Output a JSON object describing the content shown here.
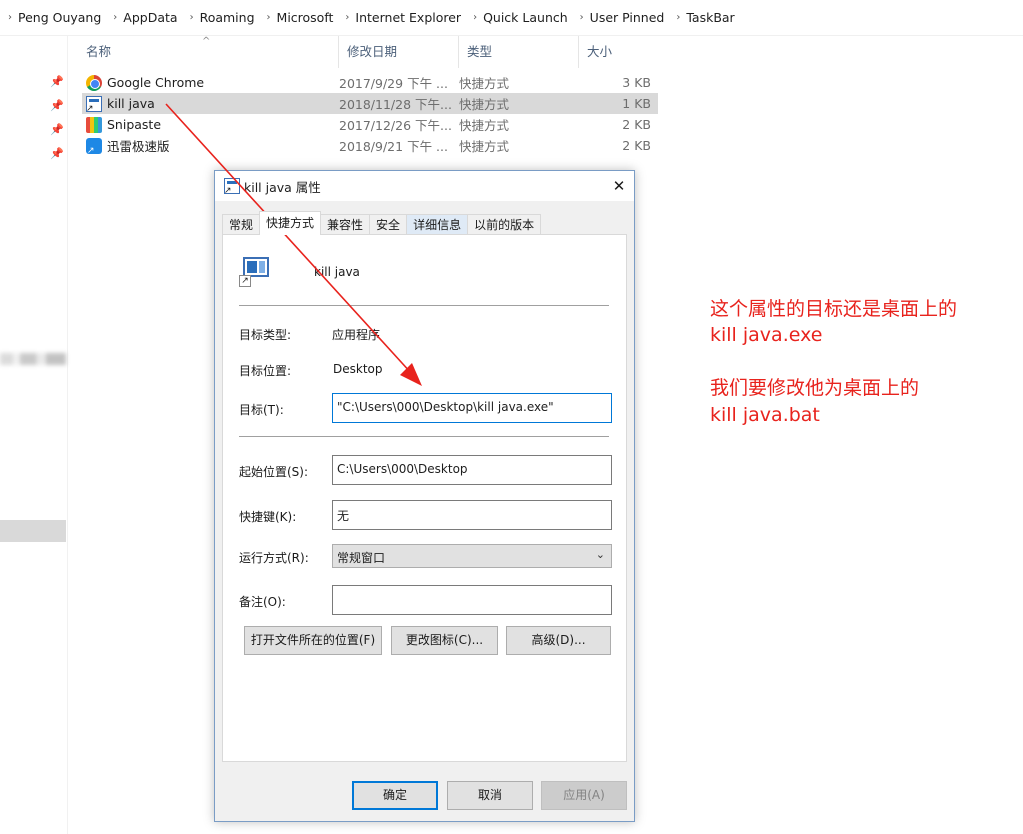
{
  "breadcrumb": [
    "Peng Ouyang",
    "AppData",
    "Roaming",
    "Microsoft",
    "Internet Explorer",
    "Quick Launch",
    "User Pinned",
    "TaskBar"
  ],
  "file_list": {
    "columns": {
      "name": "名称",
      "date": "修改日期",
      "type": "类型",
      "size": "大小"
    },
    "rows": [
      {
        "name": "Google Chrome",
        "date": "2017/9/29 下午 ...",
        "type": "快捷方式",
        "size": "3 KB",
        "icon": "chrome-icon"
      },
      {
        "name": "kill java",
        "date": "2018/11/28 下午...",
        "type": "快捷方式",
        "size": "1 KB",
        "icon": "shortcut-app-icon",
        "selected": true
      },
      {
        "name": "Snipaste",
        "date": "2017/12/26 下午...",
        "type": "快捷方式",
        "size": "2 KB",
        "icon": "snipaste-icon"
      },
      {
        "name": "迅雷极速版",
        "date": "2018/9/21 下午 ...",
        "type": "快捷方式",
        "size": "2 KB",
        "icon": "xunlei-icon"
      }
    ]
  },
  "dialog": {
    "title": "kill java 属性",
    "close": "✕",
    "tabs": [
      "常规",
      "快捷方式",
      "兼容性",
      "安全",
      "详细信息",
      "以前的版本"
    ],
    "active_tab": "快捷方式",
    "shortcut_name": "kill java",
    "target_type_label": "目标类型:",
    "target_type_value": "应用程序",
    "target_location_label": "目标位置:",
    "target_location_value": "Desktop",
    "target_label": "目标(T):",
    "target_value": "\"C:\\Users\\000\\Desktop\\kill java.exe\"",
    "start_in_label": "起始位置(S):",
    "start_in_value": "C:\\Users\\000\\Desktop",
    "hotkey_label": "快捷键(K):",
    "hotkey_value": "无",
    "run_label": "运行方式(R):",
    "run_value": "常规窗口",
    "comment_label": "备注(O):",
    "comment_value": "",
    "btn_open_location": "打开文件所在的位置(F)",
    "btn_change_icon": "更改图标(C)...",
    "btn_advanced": "高级(D)...",
    "btn_ok": "确定",
    "btn_cancel": "取消",
    "btn_apply": "应用(A)"
  },
  "annotation": {
    "line1": "这个属性的目标还是桌面上的",
    "line2": "kill java.exe",
    "line3": "我们要修改他为桌面上的",
    "line4": "kill java.bat",
    "color": "#e8231d"
  }
}
